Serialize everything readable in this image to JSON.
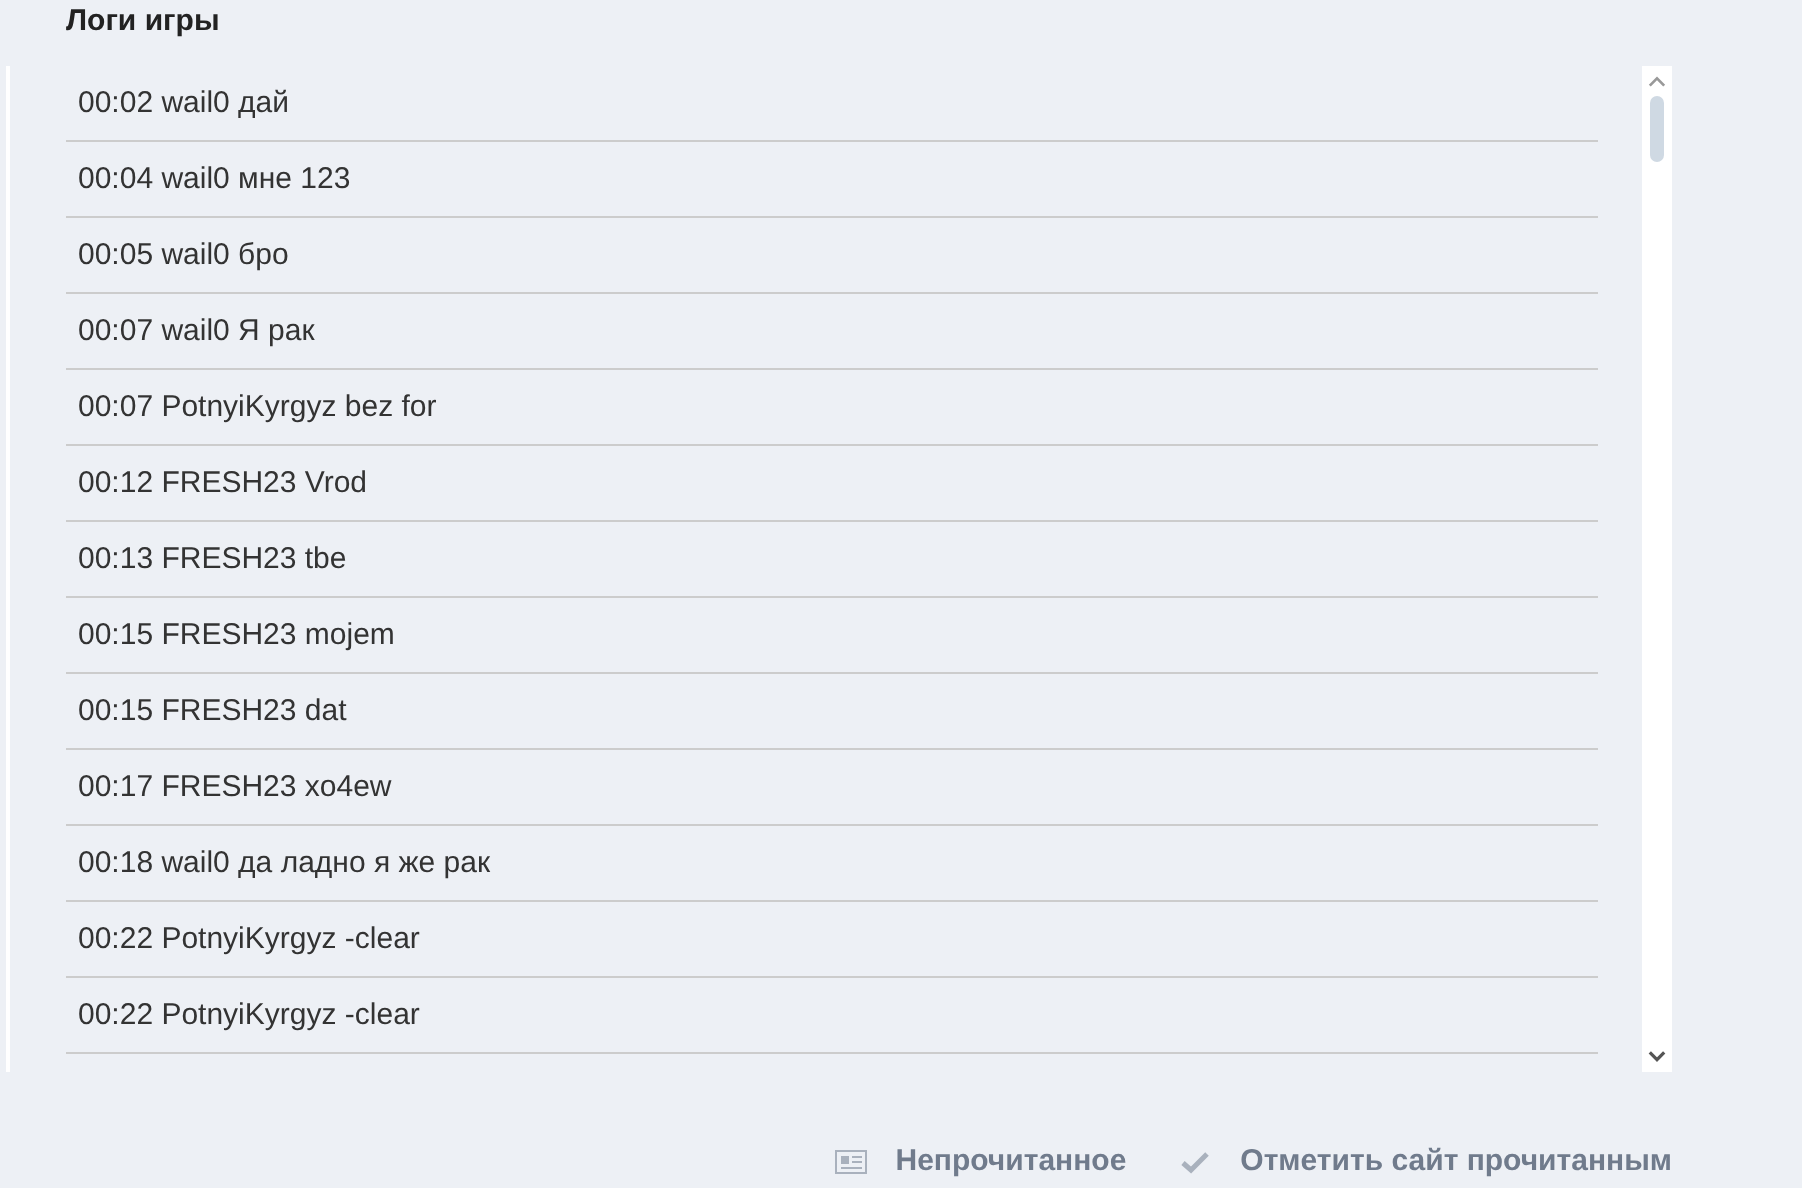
{
  "title": "Логи игры",
  "log": [
    "00:02 wail0 дай",
    "00:04 wail0 мне 123",
    "00:05 wail0 бро",
    "00:07 wail0 Я рак",
    "00:07 PotnyiKyrgyz bez for",
    "00:12 FRESH23 Vrod",
    "00:13 FRESH23 tbe",
    "00:15 FRESH23 mojem",
    "00:15 FRESH23 dat",
    "00:17 FRESH23 xo4ew",
    "00:18 wail0 да ладно я же рак",
    "00:22 PotnyiKyrgyz -clear",
    "00:22 PotnyiKyrgyz -clear"
  ],
  "footer": [
    {
      "kind": "unread",
      "label": "Непрочитанное"
    },
    {
      "kind": "mark-read",
      "label": "Отметить сайт прочитанным"
    }
  ]
}
